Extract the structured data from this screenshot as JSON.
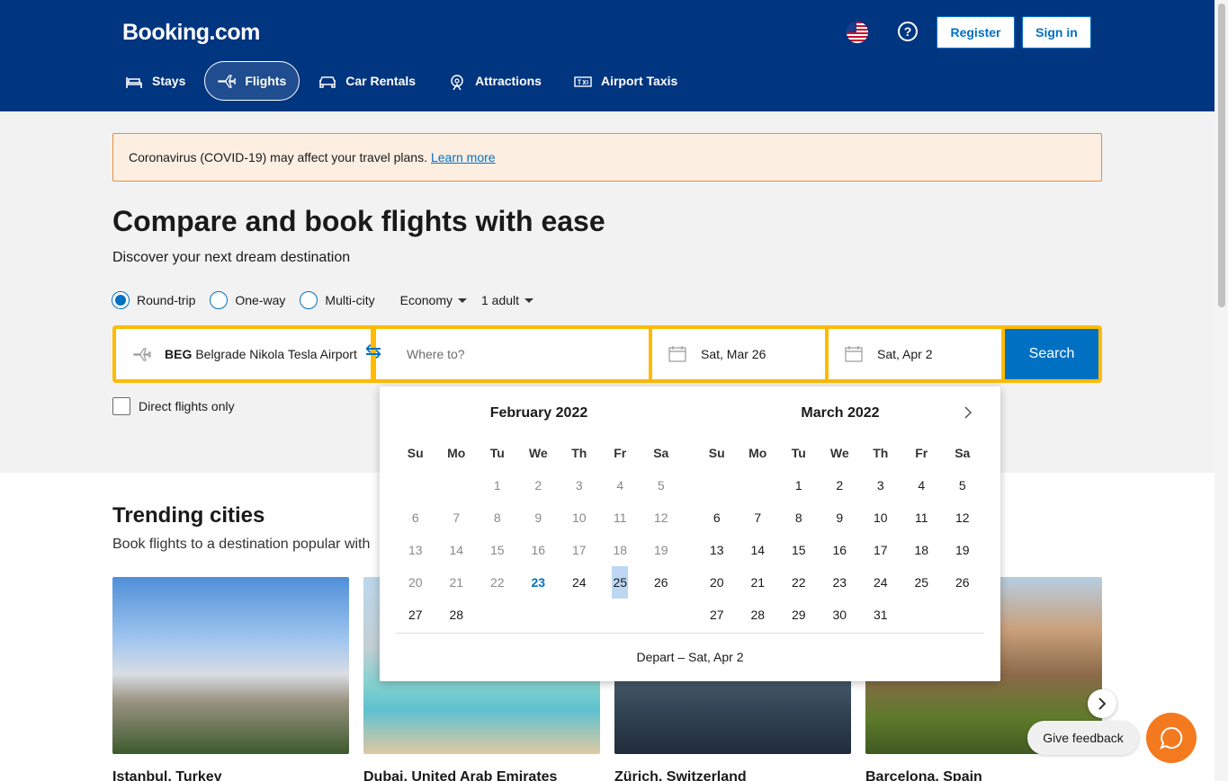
{
  "header": {
    "logo": "Booking.com",
    "register": "Register",
    "sign_in": "Sign in",
    "help": "?",
    "nav": [
      {
        "label": "Stays",
        "icon": "bed-icon"
      },
      {
        "label": "Flights",
        "icon": "plane-icon"
      },
      {
        "label": "Car Rentals",
        "icon": "car-icon"
      },
      {
        "label": "Attractions",
        "icon": "attractions-icon"
      },
      {
        "label": "Airport Taxis",
        "icon": "taxi-icon"
      }
    ]
  },
  "banner": {
    "text": "Coronavirus (COVID-19) may affect your travel plans.",
    "link": "Learn more"
  },
  "hero": {
    "title": "Compare and book flights with ease",
    "subtitle": "Discover your next dream destination"
  },
  "trip_options": {
    "round_trip": "Round-trip",
    "one_way": "One-way",
    "multi_city": "Multi-city",
    "cabin": "Economy",
    "travelers": "1 adult"
  },
  "search": {
    "from_code": "BEG",
    "from_name": "Belgrade Nikola Tesla Airport",
    "to_placeholder": "Where to?",
    "depart": "Sat, Mar 26",
    "return": "Sat, Apr 2",
    "button": "Search",
    "direct_only": "Direct flights only"
  },
  "calendar": {
    "weekdays": [
      "Su",
      "Mo",
      "Tu",
      "We",
      "Th",
      "Fr",
      "Sa"
    ],
    "months": [
      {
        "title": "February 2022",
        "weeks": [
          [
            "",
            "",
            "1",
            "2",
            "3",
            "4",
            "5"
          ],
          [
            "6",
            "7",
            "8",
            "9",
            "10",
            "11",
            "12"
          ],
          [
            "13",
            "14",
            "15",
            "16",
            "17",
            "18",
            "19"
          ],
          [
            "20",
            "21",
            "22",
            "23",
            "24",
            "25",
            "26"
          ],
          [
            "27",
            "28",
            "",
            "",
            "",
            "",
            ""
          ]
        ]
      },
      {
        "title": "March 2022",
        "weeks": [
          [
            "",
            "",
            "1",
            "2",
            "3",
            "4",
            "5"
          ],
          [
            "6",
            "7",
            "8",
            "9",
            "10",
            "11",
            "12"
          ],
          [
            "13",
            "14",
            "15",
            "16",
            "17",
            "18",
            "19"
          ],
          [
            "20",
            "21",
            "22",
            "23",
            "24",
            "25",
            "26"
          ],
          [
            "27",
            "28",
            "29",
            "30",
            "31",
            "",
            ""
          ]
        ]
      }
    ],
    "footer": "Depart – Sat, Apr 2"
  },
  "trending": {
    "title": "Trending cities",
    "subtitle": "Book flights to a destination popular with",
    "cities": [
      "Istanbul, Turkey",
      "Dubai, United Arab Emirates",
      "Zürich, Switzerland",
      "Barcelona, Spain"
    ]
  },
  "feedback": {
    "label": "Give feedback"
  },
  "colors": {
    "brand": "#003580",
    "accent": "#0071c2",
    "search_border": "#febb02",
    "chat": "#f37a1f"
  }
}
